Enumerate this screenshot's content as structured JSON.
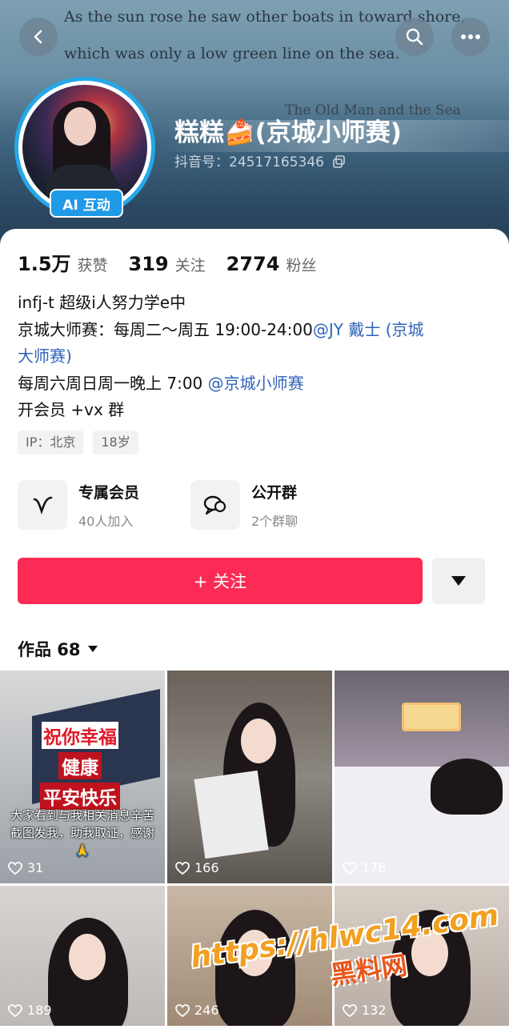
{
  "header": {
    "quote_line1": "As the sun rose he saw other boats in toward shore,",
    "quote_line2": "which was only a low green line on the sea.",
    "book_title": "The Old Man and the Sea",
    "back_icon": "chevron-left-icon",
    "search_icon": "search-icon",
    "more_icon": "more-dots-icon"
  },
  "profile": {
    "name": "糕糕🍰(京城小师赛)",
    "douyin_id_label": "抖音号：",
    "douyin_id": "24517165346",
    "ai_badge": "AI 互动",
    "avatar_ring_color": "#25a8e8"
  },
  "stats": [
    {
      "value": "1.5万",
      "label": "获赞"
    },
    {
      "value": "319",
      "label": "关注"
    },
    {
      "value": "2774",
      "label": "粉丝"
    }
  ],
  "bio": {
    "line1": "infj-t 超级i人努力学e中",
    "line2_prefix": "京城大师赛：每周二～周五 19:00-24:00",
    "line2_mention": "@JY 戴士 (京城",
    "line3_mention": "大师赛)",
    "line4_prefix": "每周六周日周一晚上 7:00 ",
    "line4_mention": "@京城小师赛",
    "line5": "开会员 +vx 群"
  },
  "tags": [
    "IP：北京",
    "18岁"
  ],
  "features": [
    {
      "title": "专属会员",
      "sub": "40人加入",
      "icon": "v-member-icon"
    },
    {
      "title": "公开群",
      "sub": "2个群聊",
      "icon": "group-chat-icon"
    }
  ],
  "actions": {
    "follow_label": "+ 关注",
    "follow_color": "#fb2b55"
  },
  "works": {
    "label": "作品 68",
    "items": [
      {
        "likes": "31",
        "caption": "大家看到与我相关消息辛苦截图发我，助我取证，感谢🙏",
        "blessing": [
          "祝你幸福",
          "健康",
          "平安快乐"
        ]
      },
      {
        "likes": "166"
      },
      {
        "likes": "176"
      },
      {
        "likes": "189"
      },
      {
        "likes": "246"
      },
      {
        "likes": "132"
      }
    ]
  },
  "watermark": {
    "url": "https://hlwc14.com",
    "name": "黑料网"
  }
}
